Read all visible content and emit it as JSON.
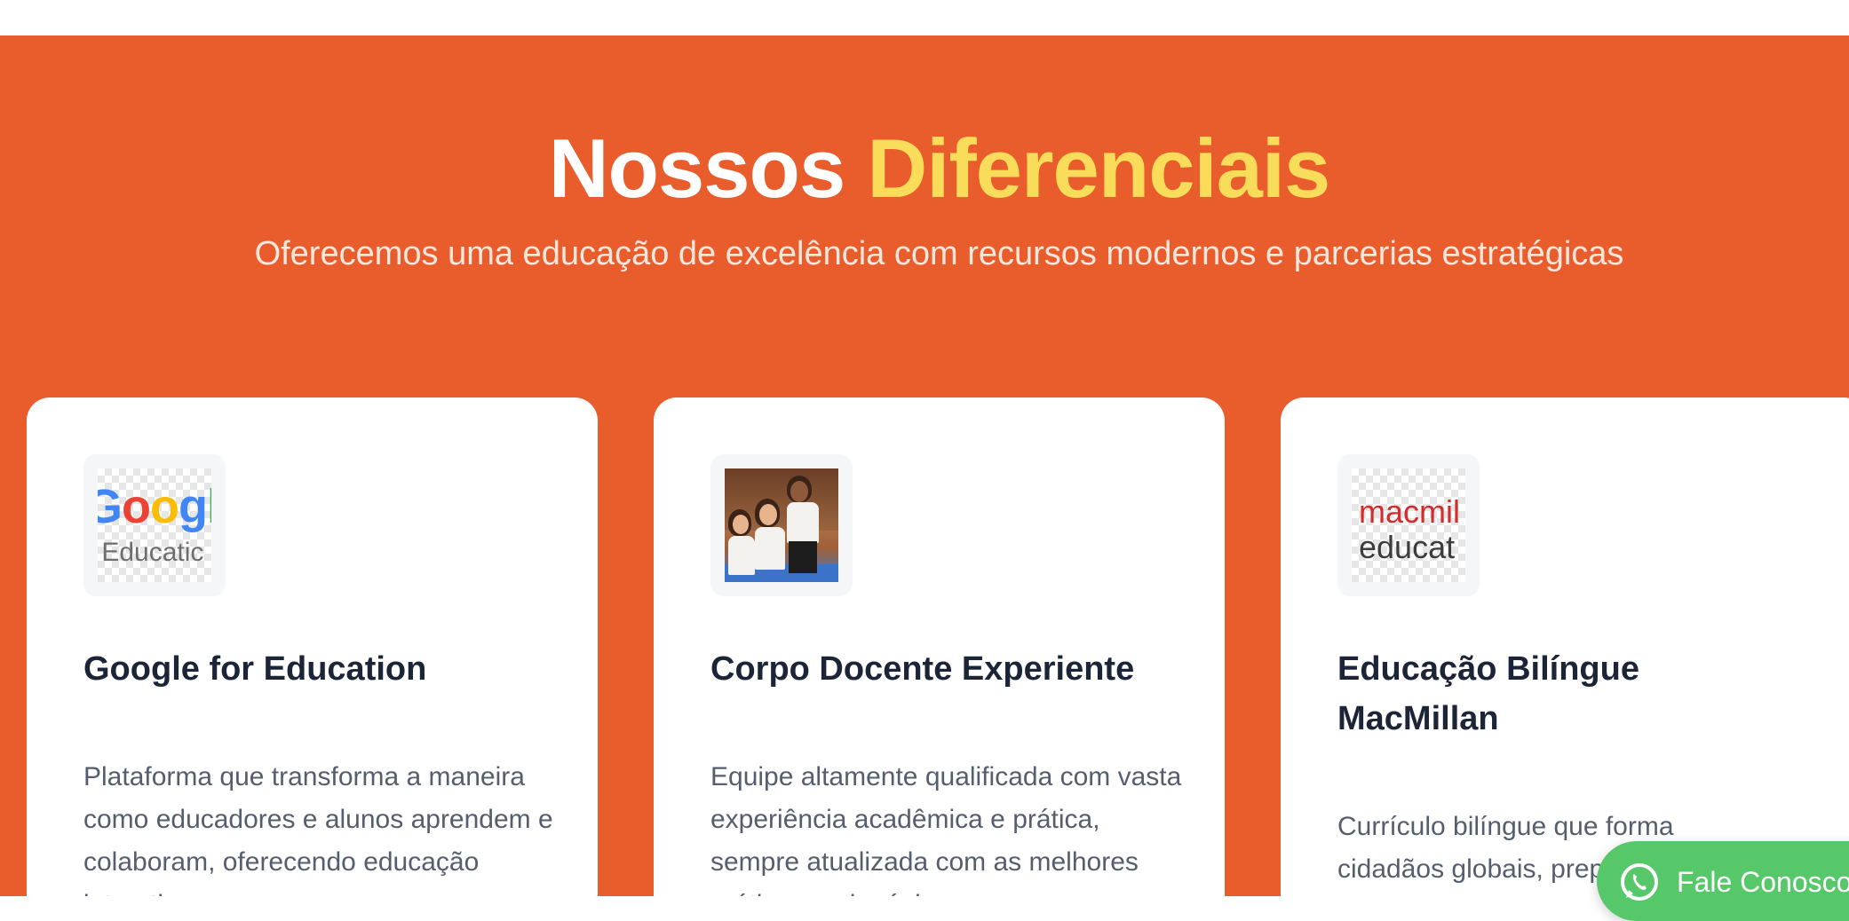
{
  "section": {
    "title_part1": "Nossos",
    "title_part2": "Diferenciais",
    "subtitle": "Oferecemos uma educação de excelência com recursos modernos e parcerias estratégicas"
  },
  "colors": {
    "section_background": "#e95c2b",
    "title_accent": "#f9dd5a",
    "card_title": "#1c2538",
    "whatsapp_button": "#56c86a"
  },
  "cards": [
    {
      "logo_name": "google-for-education-logo",
      "logo_line1_letters": [
        "G",
        "o",
        "o",
        "g",
        "l"
      ],
      "logo_line2": "r Educatic",
      "title": "Google for Education",
      "text": "Plataforma que transforma a maneira como educadores e alunos aprendem e colaboram, oferecendo educação interativa e"
    },
    {
      "logo_name": "children-photo",
      "title": "Corpo Docente Experiente",
      "text": "Equipe altamente qualificada com vasta experiência acadêmica e prática, sempre atualizada com as melhores práticas pedagógicas."
    },
    {
      "logo_name": "macmillan-education-logo",
      "logo_line1": "macmil",
      "logo_line2": "educat",
      "title": "Educação Bilíngue MacMillan",
      "text": "Currículo bilíngue que forma cidadãos globais, preparando alunos para interação"
    }
  ],
  "whatsapp": {
    "icon": "whatsapp-icon",
    "label": "Fale Conosco"
  }
}
